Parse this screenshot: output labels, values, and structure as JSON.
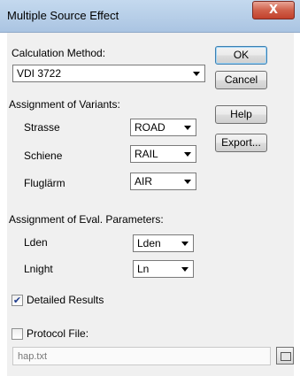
{
  "window": {
    "title": "Multiple Source Effect",
    "close_glyph": "X"
  },
  "calculation": {
    "label": "Calculation Method:",
    "value": "VDI 3722"
  },
  "variants": {
    "label": "Assignment of Variants:",
    "rows": [
      {
        "name": "Strasse",
        "value": "ROAD"
      },
      {
        "name": "Schiene",
        "value": "RAIL"
      },
      {
        "name": "Fluglärm",
        "value": "AIR"
      }
    ]
  },
  "eval_params": {
    "label": "Assignment of Eval. Parameters:",
    "rows": [
      {
        "name": "Lden",
        "value": "Lden"
      },
      {
        "name": "Lnight",
        "value": "Ln"
      }
    ]
  },
  "detailed_results": {
    "label": "Detailed Results",
    "checked": true,
    "check_glyph": "✔"
  },
  "protocol_file": {
    "label": "Protocol File:",
    "checked": false,
    "value": "hap.txt"
  },
  "buttons": {
    "ok": "OK",
    "cancel": "Cancel",
    "help": "Help",
    "export": "Export..."
  }
}
